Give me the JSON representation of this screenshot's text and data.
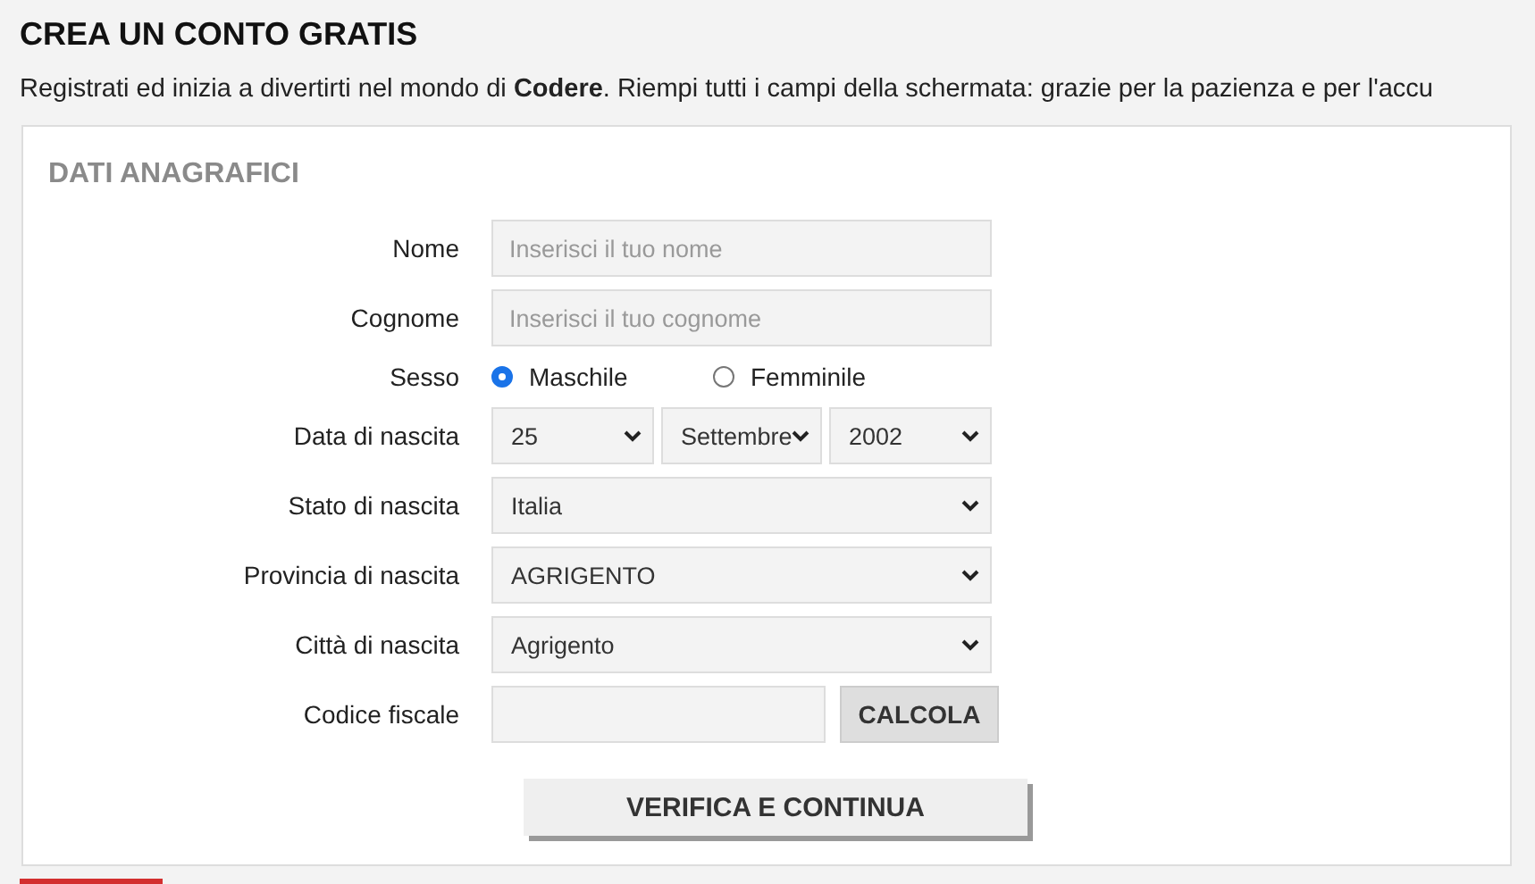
{
  "title": "CREA UN CONTO GRATIS",
  "intro": "Registrati ed inizia a divertirti nel mondo di **Codere**. Riempi tutti i campi della schermata: grazie per la pazienza e per l'accu",
  "section": {
    "title": "DATI ANAGRAFICI",
    "fields": [
      {
        "kind": "text",
        "label": "Nome",
        "placeholder": "Inserisci il tuo nome"
      },
      {
        "kind": "text",
        "label": "Cognome",
        "placeholder": "Inserisci il tuo cognome"
      },
      {
        "kind": "radio",
        "label": "Sesso",
        "options": [
          {
            "label": "Maschile",
            "selected": true
          },
          {
            "label": "Femminile",
            "selected": false
          }
        ]
      },
      {
        "kind": "date",
        "label": "Data di nascita",
        "values": [
          "25",
          "Settembre",
          "2002"
        ]
      },
      {
        "kind": "select",
        "label": "Stato di nascita",
        "value": "Italia"
      },
      {
        "kind": "select",
        "label": "Provincia di nascita",
        "value": "AGRIGENTO"
      },
      {
        "kind": "select",
        "label": "Città di nascita",
        "value": "Agrigento"
      },
      {
        "kind": "fiscal",
        "label": "Codice fiscale",
        "button": "CALCOLA"
      }
    ],
    "submit": "VERIFICA E CONTINUA"
  }
}
